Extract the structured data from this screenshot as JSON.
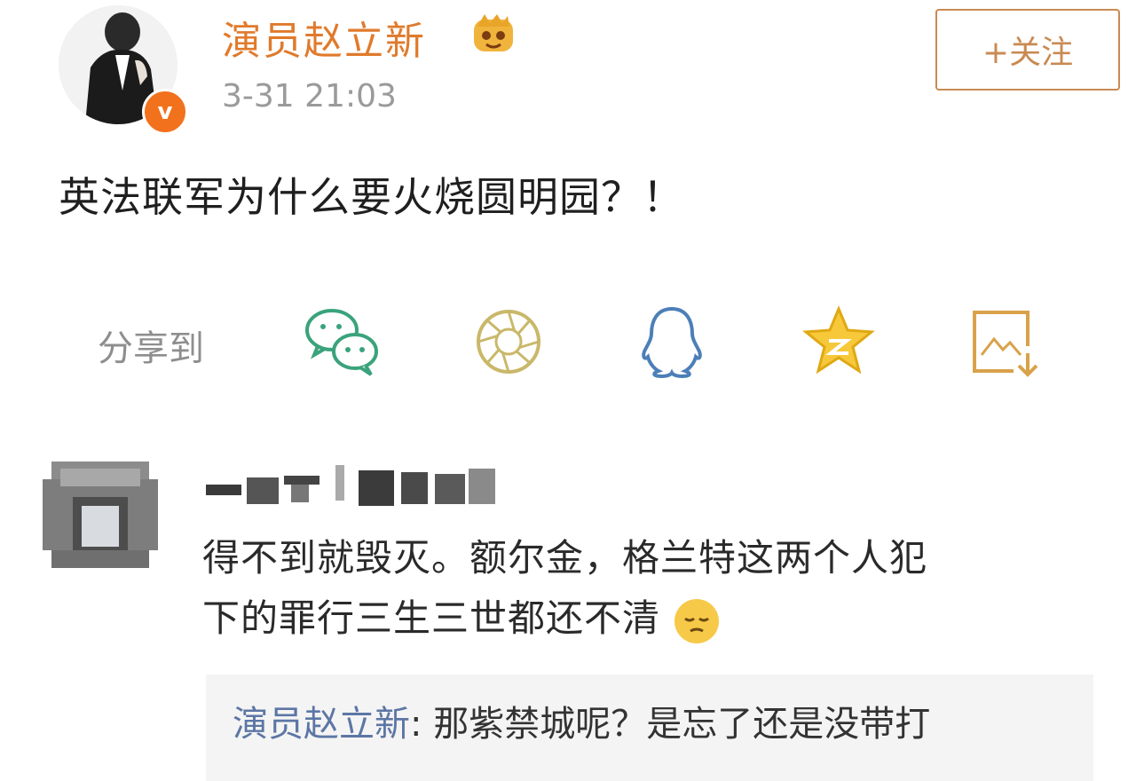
{
  "post": {
    "author": "演员赵立新",
    "timestamp": "3-31 21:03",
    "follow_label": "+关注",
    "text": "英法联军为什么要火烧圆明园？！",
    "badges": {
      "verified": "v-badge",
      "vip": "vip-crown-icon"
    }
  },
  "share": {
    "label": "分享到",
    "targets": [
      {
        "icon": "wechat-icon",
        "color": "#3aa37c"
      },
      {
        "icon": "moments-icon",
        "color": "#c9b86a"
      },
      {
        "icon": "qq-icon",
        "color": "#4c7fb8"
      },
      {
        "icon": "qzone-icon",
        "color": "#f2b712"
      },
      {
        "icon": "save-image-icon",
        "color": "#d9a24a"
      }
    ]
  },
  "comment": {
    "line1": "得不到就毁灭。额尔金，格兰特这两个人犯",
    "line2": "下的罪行三生三世都还不清",
    "emoji": "pensive-emoji",
    "reply": {
      "author": "演员赵立新",
      "text": ": 那紫禁城呢？是忘了还是没带打"
    }
  },
  "colors": {
    "author": "#e07a2c",
    "follow": "#c98a53",
    "reply_author": "#5c76a5",
    "verified": "#f2711c"
  }
}
